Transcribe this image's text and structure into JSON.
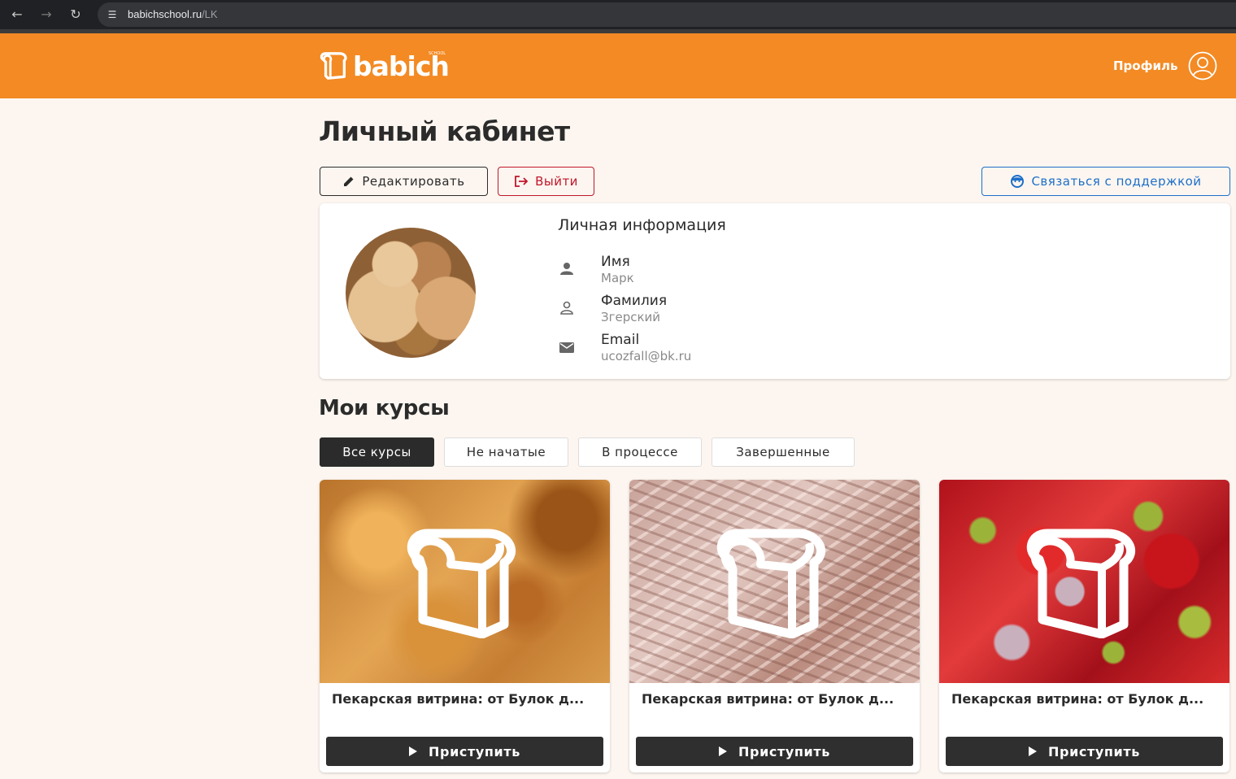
{
  "browser": {
    "url_host": "babichschool.ru",
    "url_path": "/LK"
  },
  "header": {
    "logo_text": "babich",
    "logo_sup": "SCHOOL",
    "profile_label": "Профиль",
    "bg_color": "#f38a23"
  },
  "page": {
    "title": "Личный кабинет"
  },
  "actions": {
    "edit_label": "Редактировать",
    "logout_label": "Выйти",
    "support_label": "Связаться с поддержкой"
  },
  "personal_info": {
    "title": "Личная информация",
    "first_name_label": "Имя",
    "first_name_value": "Марк",
    "last_name_label": "Фамилия",
    "last_name_value": "Згерский",
    "email_label": "Email",
    "email_value": "ucozfall@bk.ru"
  },
  "courses": {
    "title": "Мои курсы",
    "tabs": [
      {
        "label": "Все курсы",
        "active": true
      },
      {
        "label": "Не начатые",
        "active": false
      },
      {
        "label": "В процессе",
        "active": false
      },
      {
        "label": "Завершенные",
        "active": false
      }
    ],
    "items": [
      {
        "name": "Пекарская витрина: от Булок д...",
        "button": "Приступить"
      },
      {
        "name": "Пекарская витрина: от Булок д...",
        "button": "Приступить"
      },
      {
        "name": "Пекарская витрина: от Булок д...",
        "button": "Приступить"
      }
    ]
  }
}
